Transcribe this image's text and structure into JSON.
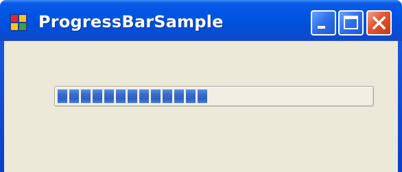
{
  "window": {
    "title": "ProgressBarSample",
    "controls": {
      "minimize": "minimize-icon",
      "maximize": "maximize-icon",
      "close": "close-icon"
    }
  },
  "progress_bar": {
    "value_fraction": 0.5,
    "chunks_filled": 13
  },
  "colors": {
    "titlebar": "#0055e4",
    "client_background": "#ece9d8",
    "progress_fill": "#2f5fc4",
    "close_button": "#e0532f"
  }
}
